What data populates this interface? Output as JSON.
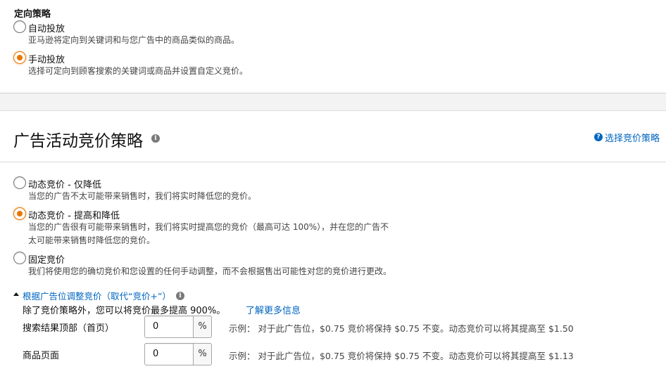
{
  "targeting": {
    "heading": "定向策略",
    "options": [
      {
        "title": "自动投放",
        "desc": "亚马逊将定向到关键词和与您广告中的商品类似的商品。",
        "checked": false
      },
      {
        "title": "手动投放",
        "desc": "选择可定向到顾客搜索的关键词或商品并设置自定义竞价。",
        "checked": true
      }
    ]
  },
  "bidding": {
    "title": "广告活动竞价策略",
    "help_link": "选择竞价策略",
    "options": [
      {
        "title": "动态竞价 - 仅降低",
        "desc": "当您的广告不太可能带来销售时，我们将实时降低您的竞价。",
        "checked": false
      },
      {
        "title": "动态竞价 - 提高和降低",
        "desc_line1": "当您的广告很有可能带来销售时，我们将实时提高您的竞价（最高可达 100%），并在您的广告不",
        "desc_line2": "太可能带来销售时降低您的竞价。",
        "checked": true
      },
      {
        "title": "固定竞价",
        "desc": "我们将使用您的确切竞价和您设置的任何手动调整，而不会根据售出可能性对您的竞价进行更改。",
        "checked": false
      }
    ],
    "placement": {
      "toggle_label": "根据广告位调整竞价（取代“竞价+”）",
      "note": "除了竞价策略外，您可以将竞价最多提高 900%。",
      "learn_more": "了解更多信息",
      "rows": [
        {
          "label": "搜索结果顶部（首页）",
          "value": "0",
          "unit": "%",
          "example": "示例： 对于此广告位，$0.75 竞价将保持 $0.75 不变。动态竞价可以将其提高至 $1.50"
        },
        {
          "label": "商品页面",
          "value": "0",
          "unit": "%",
          "example": "示例： 对于此广告位，$0.75 竞价将保持 $0.75 不变。动态竞价可以将其提高至 $1.13"
        }
      ]
    }
  },
  "colors": {
    "accent": "#e77600",
    "link": "#0066c0"
  }
}
